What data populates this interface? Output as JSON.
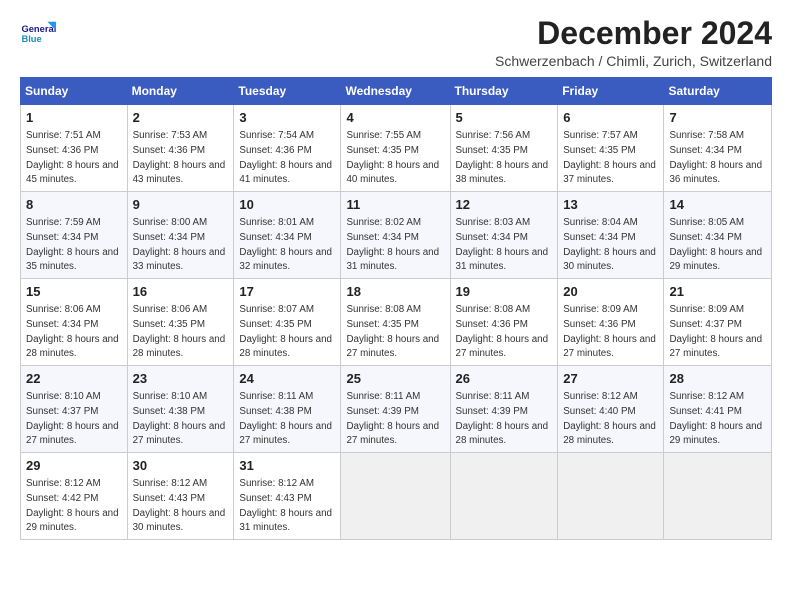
{
  "header": {
    "title": "December 2024",
    "subtitle": "Schwerzenbach / Chimli, Zurich, Switzerland"
  },
  "columns": [
    "Sunday",
    "Monday",
    "Tuesday",
    "Wednesday",
    "Thursday",
    "Friday",
    "Saturday"
  ],
  "weeks": [
    [
      {
        "day": "1",
        "sunrise": "Sunrise: 7:51 AM",
        "sunset": "Sunset: 4:36 PM",
        "daylight": "Daylight: 8 hours and 45 minutes."
      },
      {
        "day": "2",
        "sunrise": "Sunrise: 7:53 AM",
        "sunset": "Sunset: 4:36 PM",
        "daylight": "Daylight: 8 hours and 43 minutes."
      },
      {
        "day": "3",
        "sunrise": "Sunrise: 7:54 AM",
        "sunset": "Sunset: 4:36 PM",
        "daylight": "Daylight: 8 hours and 41 minutes."
      },
      {
        "day": "4",
        "sunrise": "Sunrise: 7:55 AM",
        "sunset": "Sunset: 4:35 PM",
        "daylight": "Daylight: 8 hours and 40 minutes."
      },
      {
        "day": "5",
        "sunrise": "Sunrise: 7:56 AM",
        "sunset": "Sunset: 4:35 PM",
        "daylight": "Daylight: 8 hours and 38 minutes."
      },
      {
        "day": "6",
        "sunrise": "Sunrise: 7:57 AM",
        "sunset": "Sunset: 4:35 PM",
        "daylight": "Daylight: 8 hours and 37 minutes."
      },
      {
        "day": "7",
        "sunrise": "Sunrise: 7:58 AM",
        "sunset": "Sunset: 4:34 PM",
        "daylight": "Daylight: 8 hours and 36 minutes."
      }
    ],
    [
      {
        "day": "8",
        "sunrise": "Sunrise: 7:59 AM",
        "sunset": "Sunset: 4:34 PM",
        "daylight": "Daylight: 8 hours and 35 minutes."
      },
      {
        "day": "9",
        "sunrise": "Sunrise: 8:00 AM",
        "sunset": "Sunset: 4:34 PM",
        "daylight": "Daylight: 8 hours and 33 minutes."
      },
      {
        "day": "10",
        "sunrise": "Sunrise: 8:01 AM",
        "sunset": "Sunset: 4:34 PM",
        "daylight": "Daylight: 8 hours and 32 minutes."
      },
      {
        "day": "11",
        "sunrise": "Sunrise: 8:02 AM",
        "sunset": "Sunset: 4:34 PM",
        "daylight": "Daylight: 8 hours and 31 minutes."
      },
      {
        "day": "12",
        "sunrise": "Sunrise: 8:03 AM",
        "sunset": "Sunset: 4:34 PM",
        "daylight": "Daylight: 8 hours and 31 minutes."
      },
      {
        "day": "13",
        "sunrise": "Sunrise: 8:04 AM",
        "sunset": "Sunset: 4:34 PM",
        "daylight": "Daylight: 8 hours and 30 minutes."
      },
      {
        "day": "14",
        "sunrise": "Sunrise: 8:05 AM",
        "sunset": "Sunset: 4:34 PM",
        "daylight": "Daylight: 8 hours and 29 minutes."
      }
    ],
    [
      {
        "day": "15",
        "sunrise": "Sunrise: 8:06 AM",
        "sunset": "Sunset: 4:34 PM",
        "daylight": "Daylight: 8 hours and 28 minutes."
      },
      {
        "day": "16",
        "sunrise": "Sunrise: 8:06 AM",
        "sunset": "Sunset: 4:35 PM",
        "daylight": "Daylight: 8 hours and 28 minutes."
      },
      {
        "day": "17",
        "sunrise": "Sunrise: 8:07 AM",
        "sunset": "Sunset: 4:35 PM",
        "daylight": "Daylight: 8 hours and 28 minutes."
      },
      {
        "day": "18",
        "sunrise": "Sunrise: 8:08 AM",
        "sunset": "Sunset: 4:35 PM",
        "daylight": "Daylight: 8 hours and 27 minutes."
      },
      {
        "day": "19",
        "sunrise": "Sunrise: 8:08 AM",
        "sunset": "Sunset: 4:36 PM",
        "daylight": "Daylight: 8 hours and 27 minutes."
      },
      {
        "day": "20",
        "sunrise": "Sunrise: 8:09 AM",
        "sunset": "Sunset: 4:36 PM",
        "daylight": "Daylight: 8 hours and 27 minutes."
      },
      {
        "day": "21",
        "sunrise": "Sunrise: 8:09 AM",
        "sunset": "Sunset: 4:37 PM",
        "daylight": "Daylight: 8 hours and 27 minutes."
      }
    ],
    [
      {
        "day": "22",
        "sunrise": "Sunrise: 8:10 AM",
        "sunset": "Sunset: 4:37 PM",
        "daylight": "Daylight: 8 hours and 27 minutes."
      },
      {
        "day": "23",
        "sunrise": "Sunrise: 8:10 AM",
        "sunset": "Sunset: 4:38 PM",
        "daylight": "Daylight: 8 hours and 27 minutes."
      },
      {
        "day": "24",
        "sunrise": "Sunrise: 8:11 AM",
        "sunset": "Sunset: 4:38 PM",
        "daylight": "Daylight: 8 hours and 27 minutes."
      },
      {
        "day": "25",
        "sunrise": "Sunrise: 8:11 AM",
        "sunset": "Sunset: 4:39 PM",
        "daylight": "Daylight: 8 hours and 27 minutes."
      },
      {
        "day": "26",
        "sunrise": "Sunrise: 8:11 AM",
        "sunset": "Sunset: 4:39 PM",
        "daylight": "Daylight: 8 hours and 28 minutes."
      },
      {
        "day": "27",
        "sunrise": "Sunrise: 8:12 AM",
        "sunset": "Sunset: 4:40 PM",
        "daylight": "Daylight: 8 hours and 28 minutes."
      },
      {
        "day": "28",
        "sunrise": "Sunrise: 8:12 AM",
        "sunset": "Sunset: 4:41 PM",
        "daylight": "Daylight: 8 hours and 29 minutes."
      }
    ],
    [
      {
        "day": "29",
        "sunrise": "Sunrise: 8:12 AM",
        "sunset": "Sunset: 4:42 PM",
        "daylight": "Daylight: 8 hours and 29 minutes."
      },
      {
        "day": "30",
        "sunrise": "Sunrise: 8:12 AM",
        "sunset": "Sunset: 4:43 PM",
        "daylight": "Daylight: 8 hours and 30 minutes."
      },
      {
        "day": "31",
        "sunrise": "Sunrise: 8:12 AM",
        "sunset": "Sunset: 4:43 PM",
        "daylight": "Daylight: 8 hours and 31 minutes."
      },
      null,
      null,
      null,
      null
    ]
  ]
}
